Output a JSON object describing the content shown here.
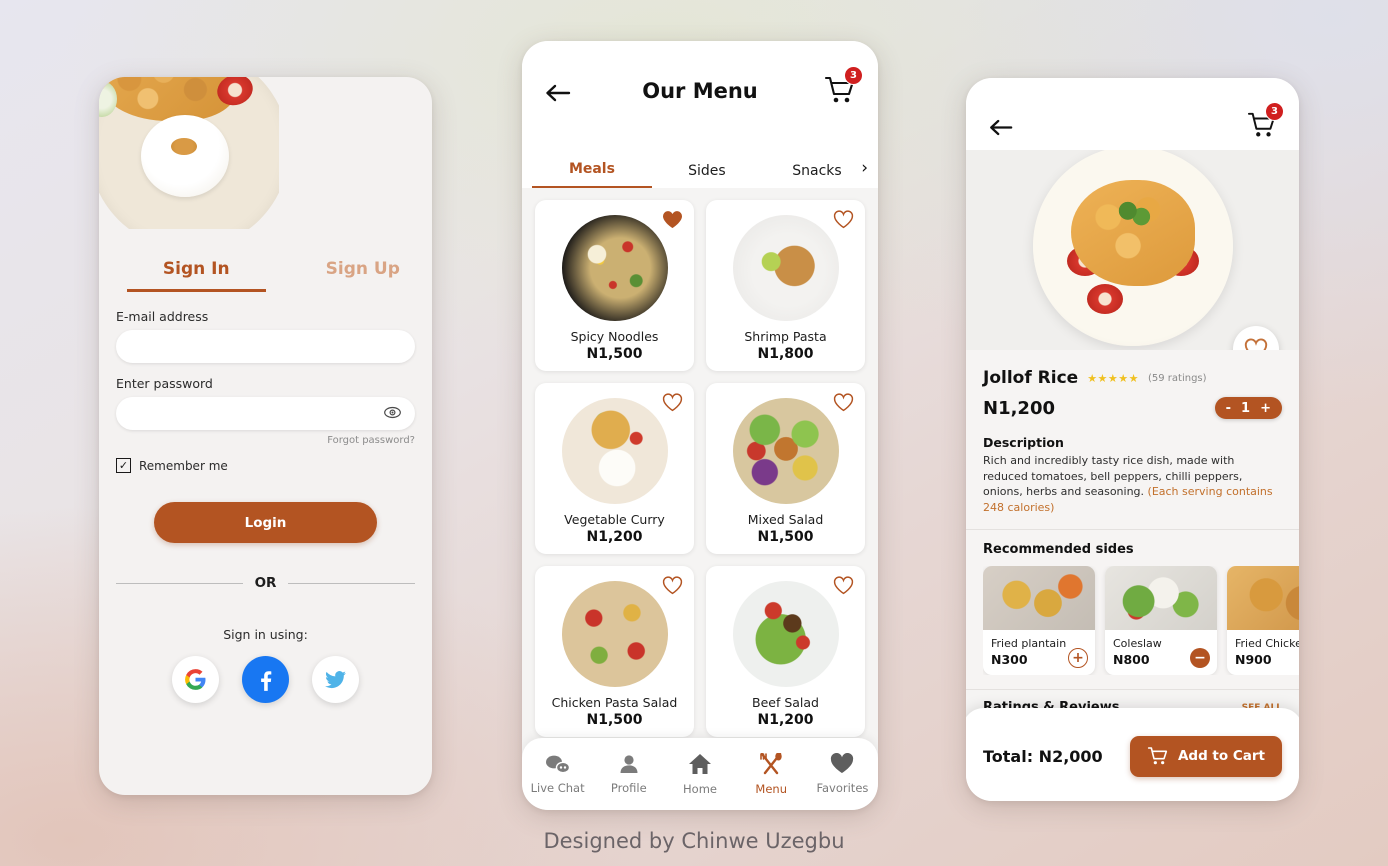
{
  "caption": "Designed by Chinwe Uzegbu",
  "colors": {
    "accent": "#b35422",
    "accent_light": "#d9a484",
    "badge": "#d01f1f",
    "star": "#f0c020"
  },
  "signin": {
    "tabs": [
      {
        "label": "Sign In",
        "active": true
      },
      {
        "label": "Sign Up",
        "active": false
      }
    ],
    "email_label": "E-mail address",
    "email_value": "",
    "email_placeholder": "",
    "password_label": "Enter password",
    "password_value": "",
    "password_placeholder": "",
    "forgot": "Forgot password?",
    "remember_label": "Remember me",
    "remember_checked": true,
    "login_label": "Login",
    "or_label": "OR",
    "social_prompt": "Sign in using:",
    "socials": [
      {
        "name": "google-icon",
        "label": "G"
      },
      {
        "name": "facebook-icon",
        "label": "f"
      },
      {
        "name": "twitter-icon",
        "label": "t"
      }
    ]
  },
  "menu": {
    "title": "Our Menu",
    "back_icon": "arrow-left-icon",
    "cart_icon": "cart-icon",
    "cart_count": "3",
    "tabs": [
      {
        "label": "Meals",
        "active": true
      },
      {
        "label": "Sides",
        "active": false
      },
      {
        "label": "Snacks",
        "active": false
      }
    ],
    "tab_more_icon": "chevron-right-icon",
    "items": [
      {
        "name": "Spicy Noodles",
        "price": "N1,500",
        "favorite": true,
        "art": "bowl-noodles"
      },
      {
        "name": "Shrimp Pasta",
        "price": "N1,800",
        "favorite": false,
        "art": "bowl-pasta"
      },
      {
        "name": "Vegetable Curry",
        "price": "N1,200",
        "favorite": false,
        "art": "bowl-curry"
      },
      {
        "name": "Mixed Salad",
        "price": "N1,500",
        "favorite": false,
        "art": "bowl-mixed"
      },
      {
        "name": "Chicken Pasta Salad",
        "price": "N1,500",
        "favorite": false,
        "art": "bowl-chick"
      },
      {
        "name": "Beef Salad",
        "price": "N1,200",
        "favorite": false,
        "art": "bowl-beef"
      }
    ],
    "nav": [
      {
        "label": "Live Chat",
        "icon": "chat-icon",
        "active": false
      },
      {
        "label": "Profile",
        "icon": "person-icon",
        "active": false
      },
      {
        "label": "Home",
        "icon": "home-icon",
        "active": false
      },
      {
        "label": "Menu",
        "icon": "cutlery-icon",
        "active": true
      },
      {
        "label": "Favorites",
        "icon": "heart-icon",
        "active": false
      }
    ]
  },
  "detail": {
    "back_icon": "arrow-left-icon",
    "cart_icon": "cart-icon",
    "cart_count": "3",
    "favorite_icon": "heart-outline-icon",
    "name": "Jollof Rice",
    "stars": "★★★★★",
    "rating_count": "(59 ratings)",
    "price": "N1,200",
    "qty_minus": "-",
    "qty_value": "1",
    "qty_plus": "+",
    "description_heading": "Description",
    "description_body": "Rich and incredibly tasty rice dish, made with reduced tomatoes, bell peppers, chilli peppers, onions, herbs and seasoning. ",
    "calories_note": "(Each serving contains 248 calories)",
    "sides_heading": "Recommended sides",
    "sides": [
      {
        "name": "Fried plantain",
        "price": "N300",
        "action": "+",
        "action_kind": "add",
        "art": "si-plantain"
      },
      {
        "name": "Coleslaw",
        "price": "N800",
        "action": "−",
        "action_kind": "remove",
        "art": "si-coleslaw"
      },
      {
        "name": "Fried Chicken",
        "price": "N900",
        "action": "",
        "action_kind": "none",
        "art": "si-chicken"
      }
    ],
    "reviews_heading": "Ratings & Reviews",
    "reviews_see_all": "SEE ALL",
    "total_label": "Total: N2,000",
    "add_to_cart_label": "Add to Cart",
    "add_to_cart_icon": "cart-icon"
  }
}
